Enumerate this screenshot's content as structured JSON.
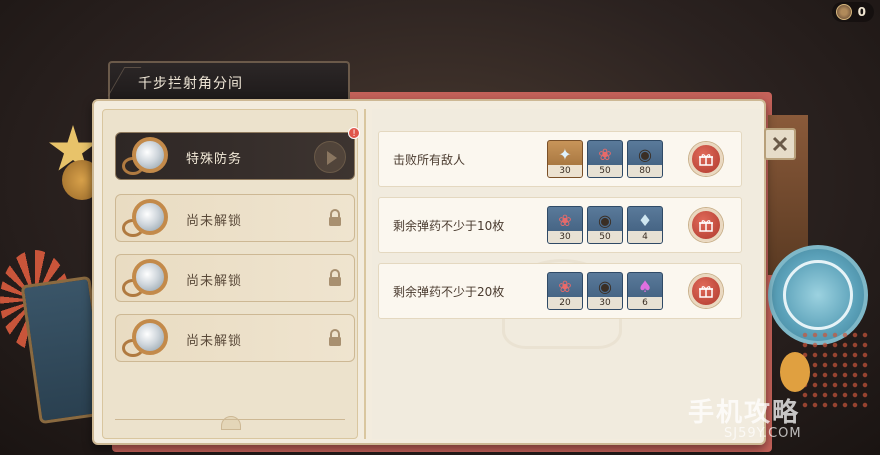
{
  "header": {
    "faint_title": "",
    "currency_value": "0",
    "currency_icon": "coin-icon"
  },
  "window": {
    "title": "千步拦射角分间",
    "close_icon": "close-icon"
  },
  "levels": [
    {
      "label": "特殊防务",
      "state": "active",
      "badge": "!"
    },
    {
      "label": "尚未解锁",
      "state": "locked"
    },
    {
      "label": "尚未解锁",
      "state": "locked"
    },
    {
      "label": "尚未解锁",
      "state": "locked"
    }
  ],
  "objectives": [
    {
      "text": "击败所有敌人",
      "rewards": [
        {
          "icon": "crystal-icon",
          "count": "30",
          "style": "gold"
        },
        {
          "icon": "coral-icon",
          "count": "50",
          "style": "blue"
        },
        {
          "icon": "film-reel-icon",
          "count": "80",
          "style": "blue"
        }
      ]
    },
    {
      "text": "剩余弹药不少于10枚",
      "rewards": [
        {
          "icon": "coral-icon",
          "count": "30",
          "style": "blue"
        },
        {
          "icon": "film-reel-icon",
          "count": "50",
          "style": "blue"
        },
        {
          "icon": "potion-icon",
          "count": "4",
          "style": "blue"
        }
      ]
    },
    {
      "text": "剩余弹药不少于20枚",
      "rewards": [
        {
          "icon": "coral-icon",
          "count": "20",
          "style": "blue"
        },
        {
          "icon": "film-reel-icon",
          "count": "30",
          "style": "blue"
        },
        {
          "icon": "crystal-cluster-icon",
          "count": "6",
          "style": "blue"
        }
      ]
    }
  ],
  "watermark": {
    "big": "手机攻略",
    "small": "SJ59Y.COM"
  }
}
